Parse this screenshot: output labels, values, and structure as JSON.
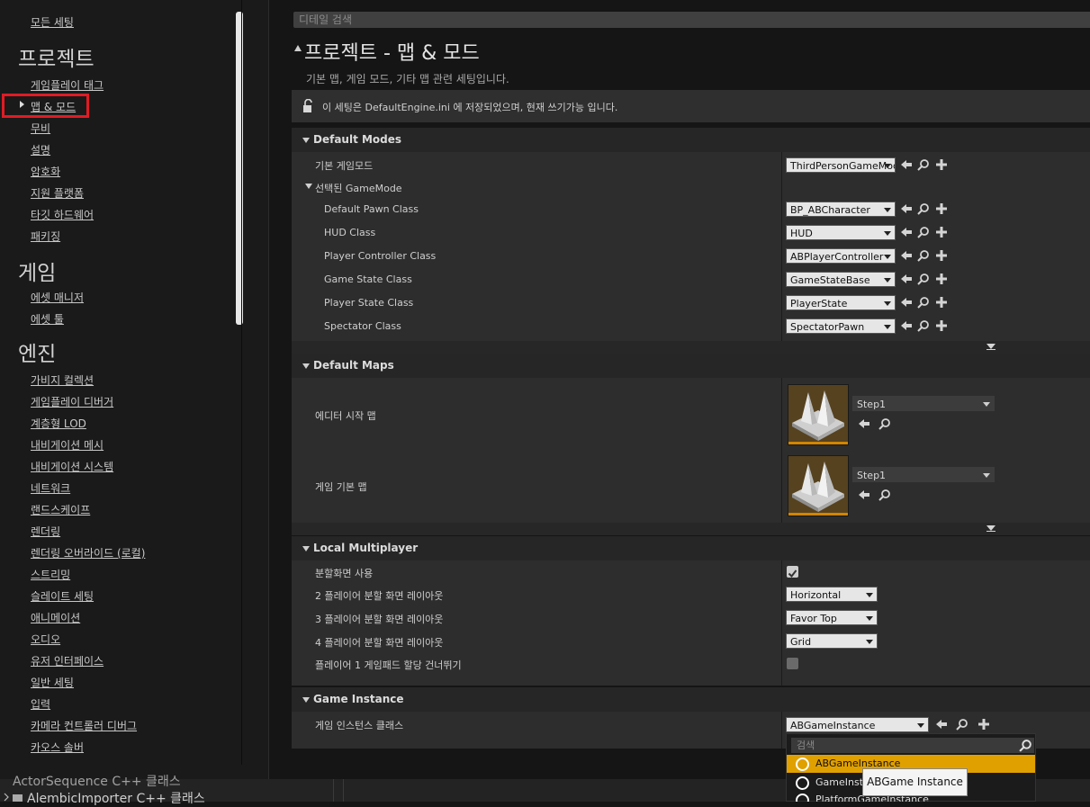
{
  "nav": {
    "items_top": [
      {
        "label": "모든 세팅"
      }
    ],
    "categories": [
      {
        "title": "프로젝트",
        "items": [
          "게임플레이 태그",
          "맵 & 모드",
          "무비",
          "설명",
          "암호화",
          "지원 플랫폼",
          "타깃 하드웨어",
          "패키징"
        ]
      },
      {
        "title": "게임",
        "items": [
          "에셋 매니저",
          "에셋 툴"
        ]
      },
      {
        "title": "엔진",
        "items": [
          "가비지 컬렉션",
          "게임플레이 디버거",
          "계층형 LOD",
          "내비게이션 메시",
          "내비게이션 시스템",
          "네트워크",
          "랜드스케이프",
          "렌더링",
          "렌더링 오버라이드 (로컬)",
          "스트리밍",
          "슬레이트 세팅",
          "애니메이션",
          "오디오",
          "유저 인터페이스",
          "일반 세팅",
          "입력",
          "카메라 컨트롤러 디버그",
          "카오스 솔버"
        ]
      }
    ],
    "selected": "맵 & 모드",
    "highlight_color": "#e01b24"
  },
  "details": {
    "search_placeholder": "디테일 검색",
    "title": "프로젝트 - 맵 & 모드",
    "subtitle": "기본 맵, 게임 모드, 기타 맵 관련 세팅입니다.",
    "notice": "이 세팅은 DefaultEngine.ini 에 저장되었으며, 현재 쓰기가능 입니다."
  },
  "default_modes": {
    "header": "Default Modes",
    "default_gamemode_label": "기본 게임모드",
    "default_gamemode_value": "ThirdPersonGameMode",
    "selected_gamemode_label": "선택된 GameMode",
    "rows": [
      {
        "label": "Default Pawn Class",
        "value": "BP_ABCharacter"
      },
      {
        "label": "HUD Class",
        "value": "HUD"
      },
      {
        "label": "Player Controller Class",
        "value": "ABPlayerController"
      },
      {
        "label": "Game State Class",
        "value": "GameStateBase"
      },
      {
        "label": "Player State Class",
        "value": "PlayerState"
      },
      {
        "label": "Spectator Class",
        "value": "SpectatorPawn"
      }
    ]
  },
  "default_maps": {
    "header": "Default Maps",
    "rows": [
      {
        "label": "에디터 시작 맵",
        "value": "Step1"
      },
      {
        "label": "게임 기본 맵",
        "value": "Step1"
      }
    ]
  },
  "local_multiplayer": {
    "header": "Local Multiplayer",
    "split_screen_label": "분할화면 사용",
    "split_screen_checked": true,
    "layouts": [
      {
        "label": "2 플레이어 분할 화면 레이아웃",
        "value": "Horizontal"
      },
      {
        "label": "3 플레이어 분할 화면 레이아웃",
        "value": "Favor Top"
      },
      {
        "label": "4 플레이어 분할 화면 레이아웃",
        "value": "Grid"
      }
    ],
    "skip_gamepad_label": "플레이어 1 게임패드 할당 건너뛰기",
    "skip_gamepad_checked": false
  },
  "game_instance": {
    "header": "Game Instance",
    "label": "게임 인스턴스 클래스",
    "value": "ABGameInstance",
    "dropdown": {
      "search_placeholder": "검색",
      "items": [
        "ABGameInstance",
        "GameInstance",
        "PlatformGameInstance"
      ],
      "highlight_color": "#e0a000"
    },
    "tooltip": "ABGame Instance"
  },
  "bottom": {
    "left_text": "ActorSequence C++ 클래스",
    "left_text2": "AlembicImporter C++ 클래스"
  }
}
